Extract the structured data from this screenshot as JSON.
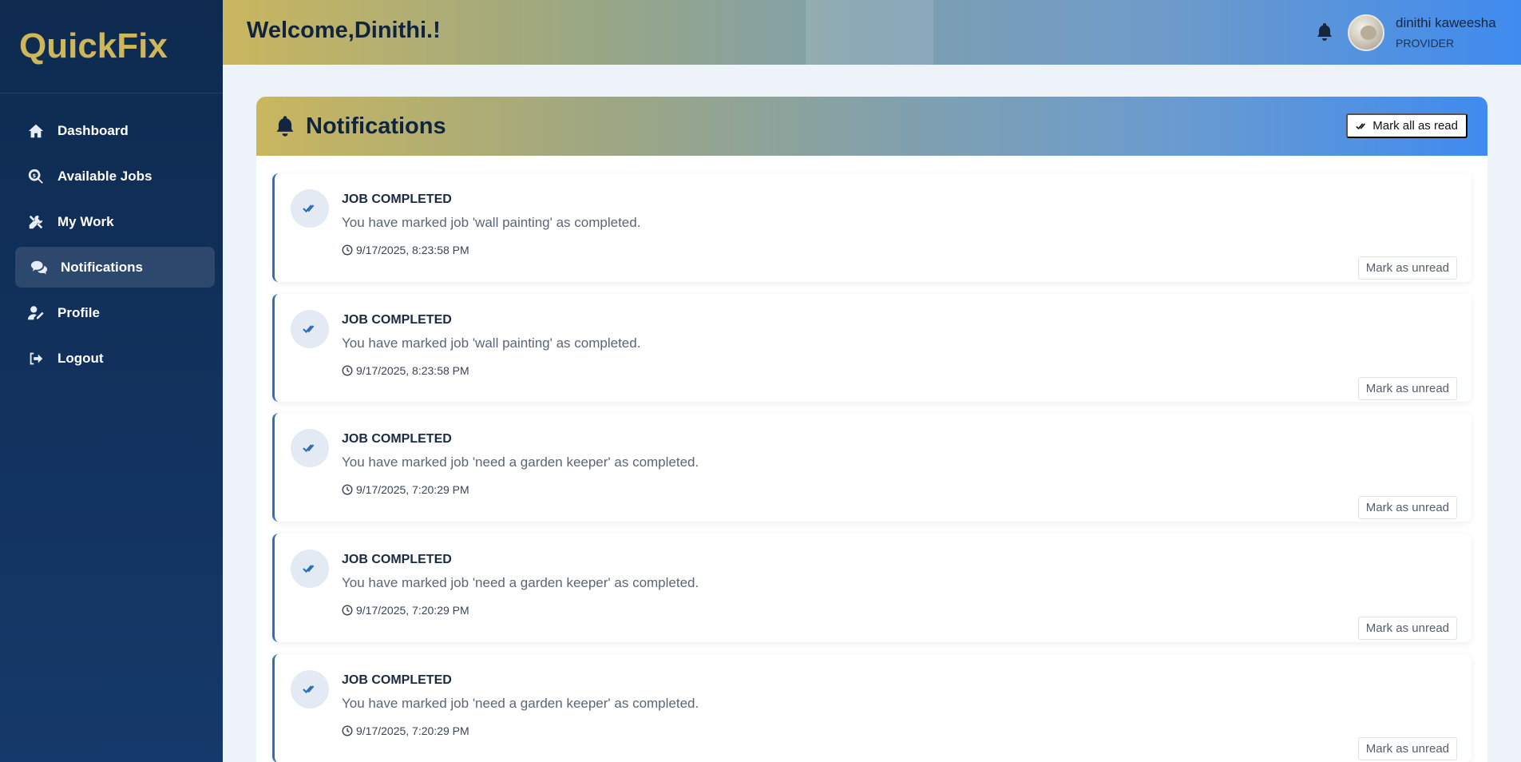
{
  "app": {
    "name": "QuickFix"
  },
  "sidebar": {
    "items": [
      {
        "label": "Dashboard",
        "icon": "home-icon"
      },
      {
        "label": "Available Jobs",
        "icon": "search-dollar-icon"
      },
      {
        "label": "My Work",
        "icon": "tools-icon"
      },
      {
        "label": "Notifications",
        "icon": "comments-icon",
        "active": true
      },
      {
        "label": "Profile",
        "icon": "user-edit-icon"
      },
      {
        "label": "Logout",
        "icon": "logout-icon"
      }
    ]
  },
  "header": {
    "welcome": "Welcome,Dinithi.!",
    "user": {
      "name": "dinithi kaweesha",
      "role": "PROVIDER"
    }
  },
  "notifications": {
    "title": "Notifications",
    "mark_all_label": "Mark all as read",
    "items": [
      {
        "title": "JOB COMPLETED",
        "message": "You have marked job 'wall painting' as completed.",
        "time": "9/17/2025, 8:23:58 PM",
        "action": "Mark as unread"
      },
      {
        "title": "JOB COMPLETED",
        "message": "You have marked job 'wall painting' as completed.",
        "time": "9/17/2025, 8:23:58 PM",
        "action": "Mark as unread"
      },
      {
        "title": "JOB COMPLETED",
        "message": "You have marked job 'need a garden keeper' as completed.",
        "time": "9/17/2025, 7:20:29 PM",
        "action": "Mark as unread"
      },
      {
        "title": "JOB COMPLETED",
        "message": "You have marked job 'need a garden keeper' as completed.",
        "time": "9/17/2025, 7:20:29 PM",
        "action": "Mark as unread"
      },
      {
        "title": "JOB COMPLETED",
        "message": "You have marked job 'need a garden keeper' as completed.",
        "time": "9/17/2025, 7:20:29 PM",
        "action": "Mark as unread"
      }
    ]
  },
  "colors": {
    "sidebar_bg": "#0e2a4f",
    "logo": "#cdb75a",
    "accent_blue": "#3f8bf0",
    "accent_gold": "#c9b65f",
    "card_border": "#2f6fb3"
  }
}
